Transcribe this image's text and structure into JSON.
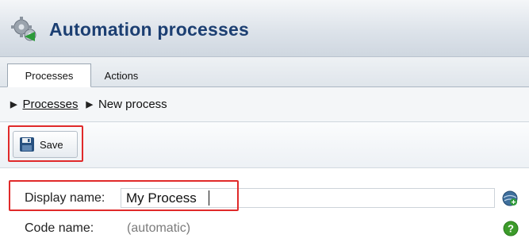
{
  "header": {
    "title": "Automation processes",
    "icon": "gear-icon"
  },
  "tabs": [
    {
      "label": "Processes",
      "active": true
    },
    {
      "label": "Actions",
      "active": false
    }
  ],
  "breadcrumb": {
    "link_label": "Processes",
    "current_label": "New process"
  },
  "toolbar": {
    "save_label": "Save",
    "save_icon": "floppy-disk-icon"
  },
  "form": {
    "display_name_label": "Display name:",
    "display_name_value": "My Process",
    "code_name_label": "Code name:",
    "code_name_value": "(automatic)",
    "localize_icon": "globe-plus-icon",
    "help_icon": "help-icon"
  },
  "colors": {
    "title": "#1c3f72",
    "highlight": "#e02a2a",
    "help_green": "#3c9b2a"
  }
}
